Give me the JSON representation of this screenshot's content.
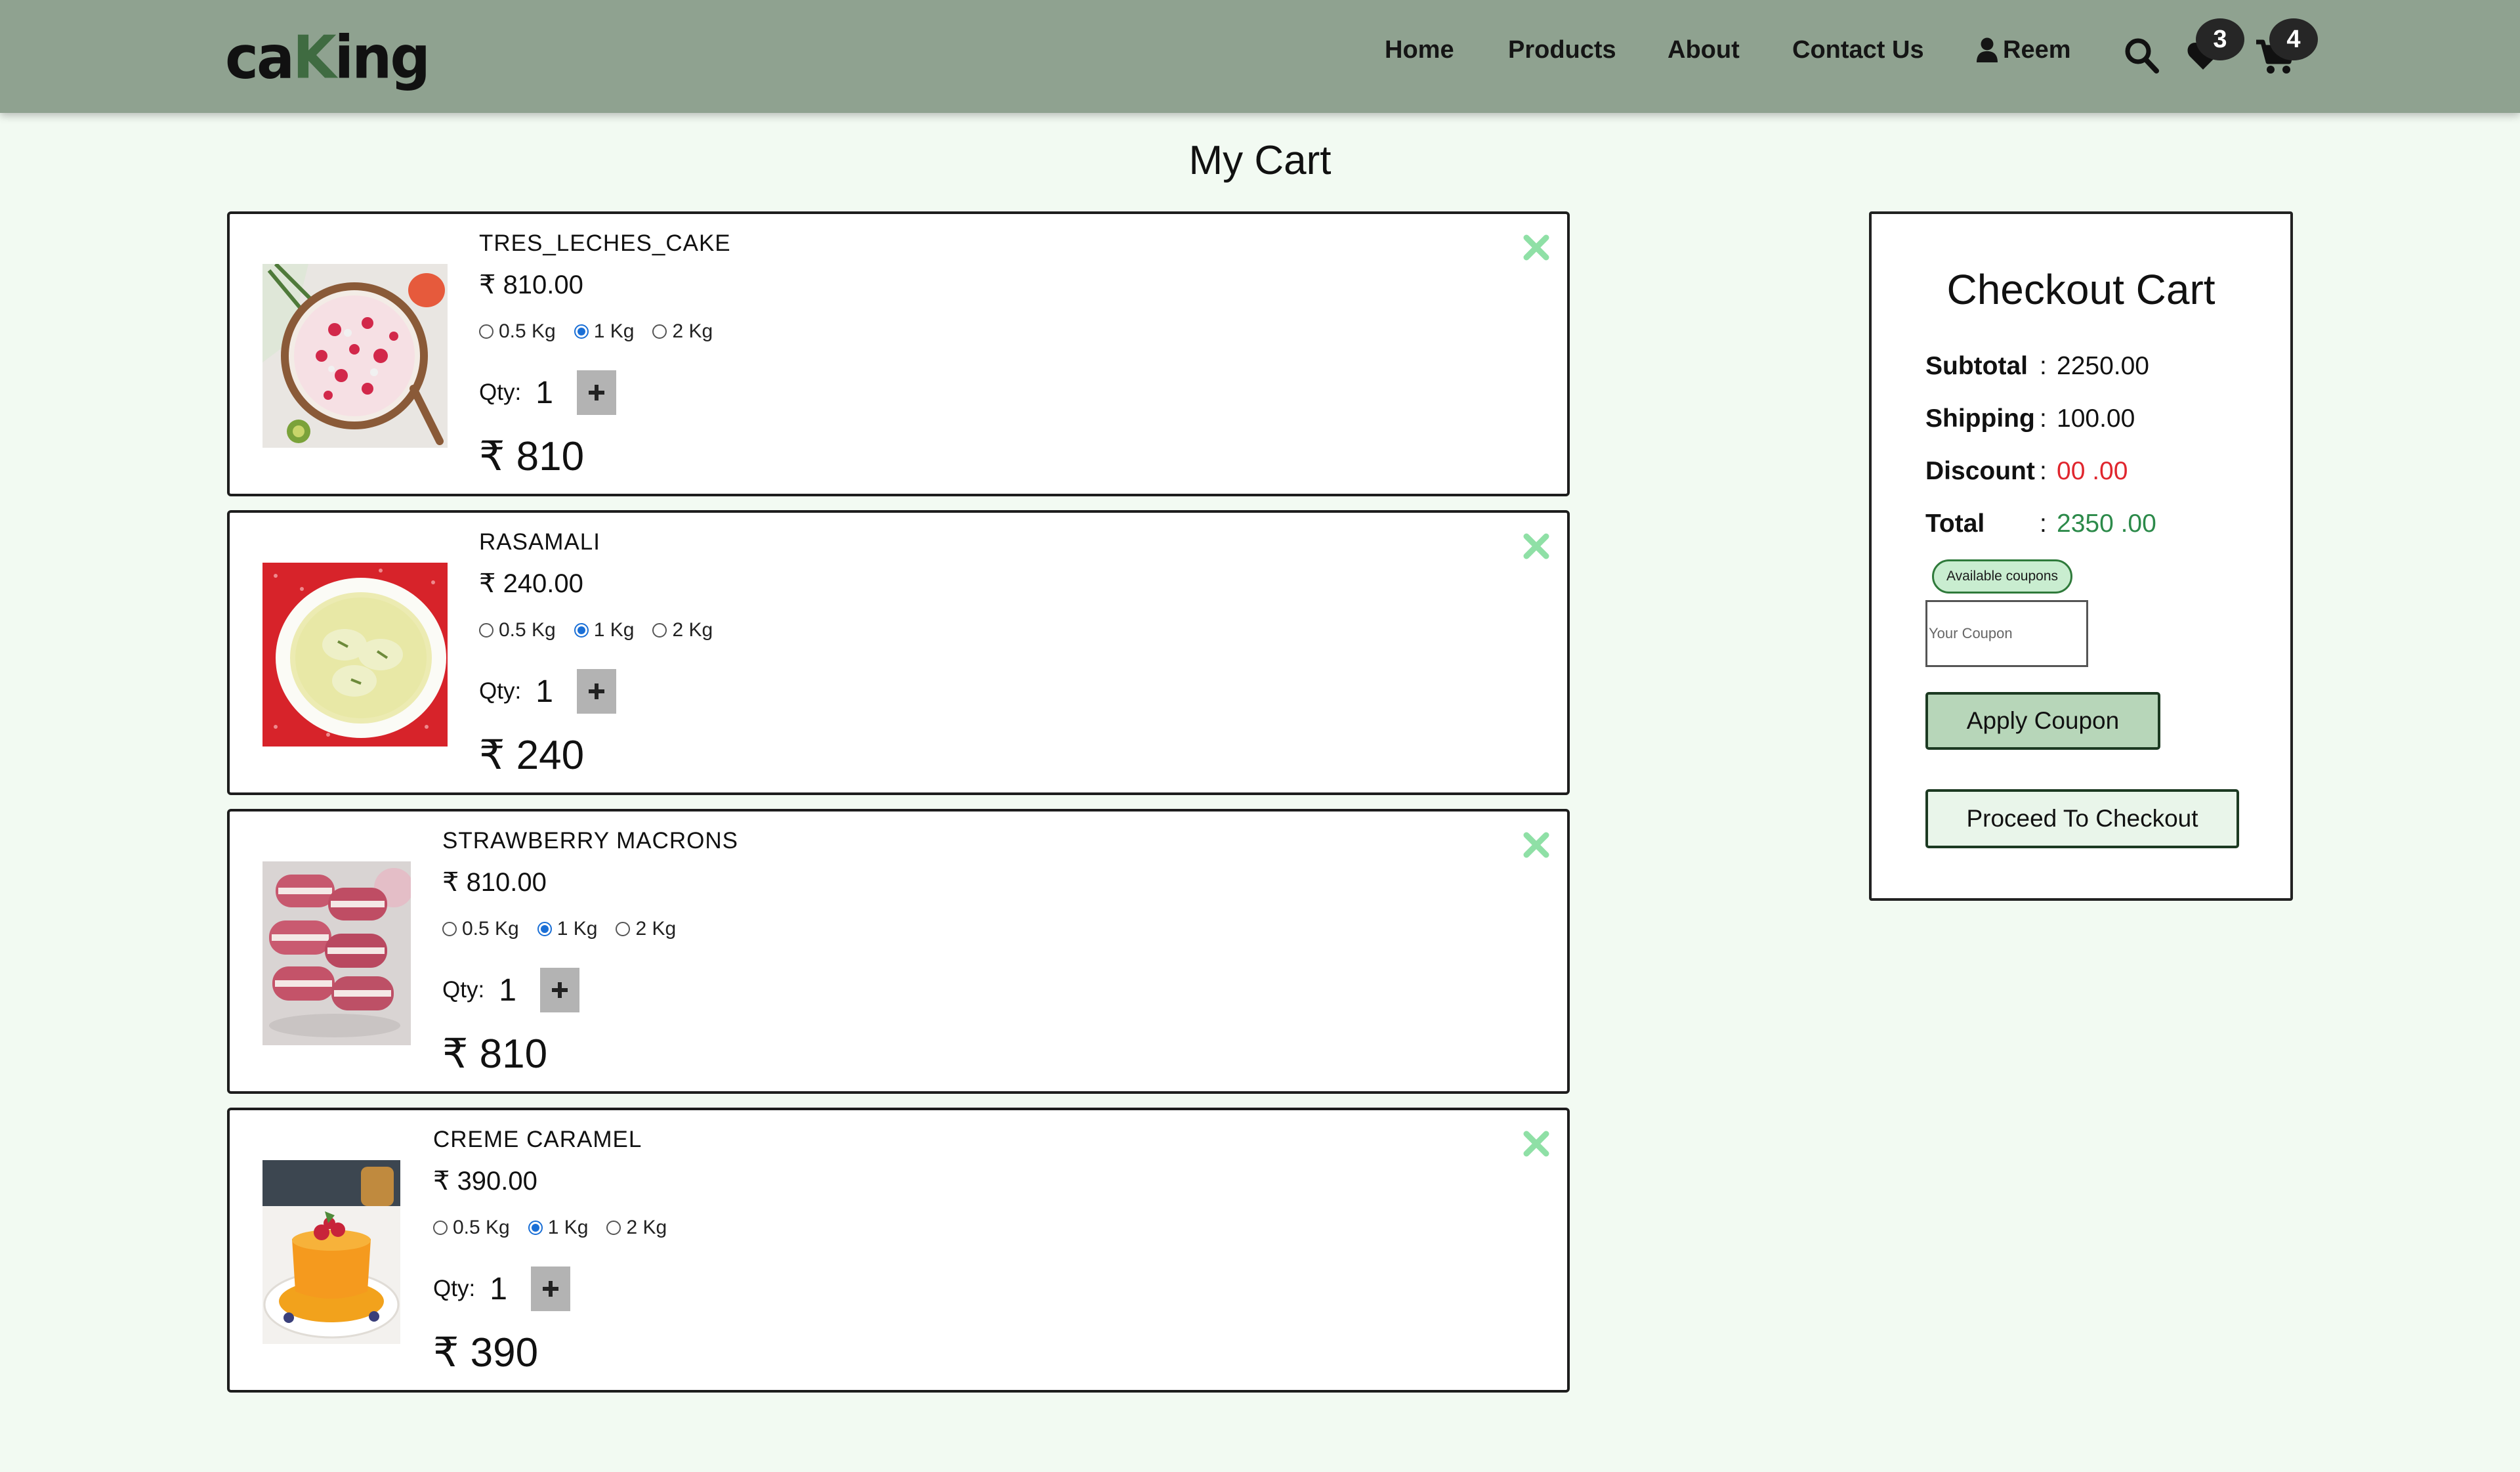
{
  "header": {
    "logo_prefix": "ca",
    "logo_k": "K",
    "logo_suffix": "ing",
    "nav": [
      "Home",
      "Products",
      "About",
      "Contact Us"
    ],
    "user_name": "Reem",
    "wishlist_count": "3",
    "cart_count": "4",
    "icons": [
      "user-icon",
      "search-icon",
      "heart-icon",
      "cart-icon"
    ]
  },
  "page_title": "My Cart",
  "currency_symbol": "₹",
  "cart_items": [
    {
      "name": "TRES_LECHES_CAKE",
      "price": "₹ 810.00",
      "sizes": [
        "0.5 Kg",
        "1 Kg",
        "2 Kg"
      ],
      "selected_size": "1 Kg",
      "qty_label": "Qty:",
      "qty": "1",
      "total": "₹ 810"
    },
    {
      "name": "RASAMALI",
      "price": "₹ 240.00",
      "sizes": [
        "0.5 Kg",
        "1 Kg",
        "2 Kg"
      ],
      "selected_size": "1 Kg",
      "qty_label": "Qty:",
      "qty": "1",
      "total": "₹ 240"
    },
    {
      "name": "STRAWBERRY MACRONS",
      "price": "₹ 810.00",
      "sizes": [
        "0.5 Kg",
        "1 Kg",
        "2 Kg"
      ],
      "selected_size": "1 Kg",
      "qty_label": "Qty:",
      "qty": "1",
      "total": "₹ 810"
    },
    {
      "name": "CREME CARAMEL",
      "price": "₹ 390.00",
      "sizes": [
        "0.5 Kg",
        "1 Kg",
        "2 Kg"
      ],
      "selected_size": "1 Kg",
      "qty_label": "Qty:",
      "qty": "1",
      "total": "₹ 390"
    }
  ],
  "checkout": {
    "title": "Checkout Cart",
    "subtotal_label": "Subtotal",
    "subtotal": "2250.00",
    "shipping_label": "Shipping",
    "shipping": "100.00",
    "discount_label": "Discount",
    "discount": "00 .00",
    "total_label": "Total",
    "total": "2350 .00",
    "separator": ":",
    "coupons_pill": "Available coupons",
    "coupon_placeholder": "Your Coupon",
    "apply_label": "Apply Coupon",
    "proceed_label": "Proceed To Checkout"
  },
  "colors": {
    "header_bg": "#8fa290",
    "page_bg": "#f2faf2",
    "discount": "#e0262e",
    "total": "#2c8a4a",
    "remove_icon": "#8fe0a6",
    "apply_bg": "#b7d6b9"
  }
}
